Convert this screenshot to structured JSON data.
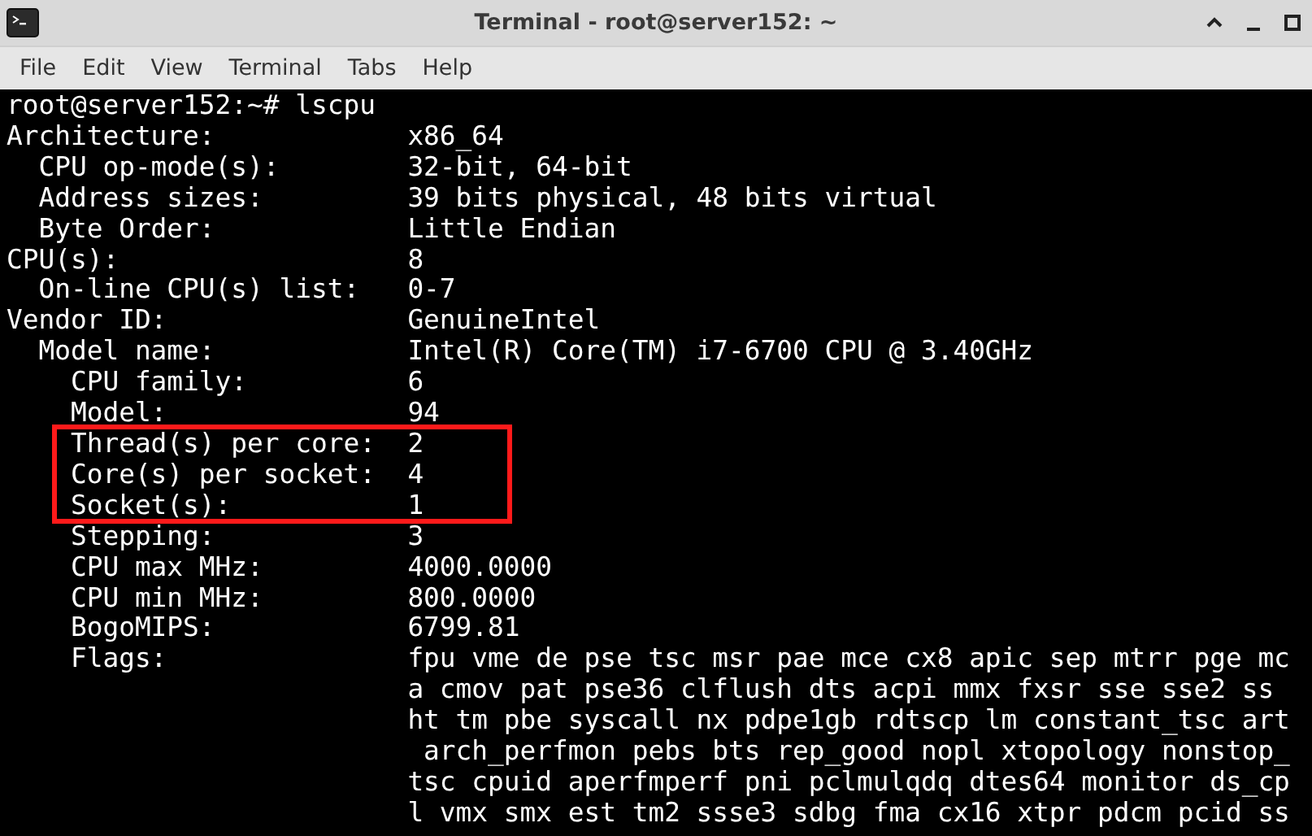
{
  "window": {
    "title": "Terminal - root@server152: ~"
  },
  "menu": [
    "File",
    "Edit",
    "View",
    "Terminal",
    "Tabs",
    "Help"
  ],
  "terminal": {
    "prompt": "root@server152:~# lscpu",
    "fields": [
      {
        "key": "Architecture:",
        "value": [
          "x86_64"
        ],
        "highlighted": false,
        "children": [
          {
            "key": "CPU op-mode(s):",
            "value": [
              "32-bit, 64-bit"
            ],
            "highlighted": false
          },
          {
            "key": "Address sizes:",
            "value": [
              "39 bits physical, 48 bits virtual"
            ],
            "highlighted": false
          },
          {
            "key": "Byte Order:",
            "value": [
              "Little Endian"
            ],
            "highlighted": false
          }
        ]
      },
      {
        "key": "CPU(s):",
        "value": [
          "8"
        ],
        "highlighted": false,
        "children": [
          {
            "key": "On-line CPU(s) list:",
            "value": [
              "0-7"
            ],
            "highlighted": false
          }
        ]
      },
      {
        "key": "Vendor ID:",
        "value": [
          "GenuineIntel"
        ],
        "highlighted": false,
        "children": [
          {
            "key": "Model name:",
            "value": [
              "Intel(R) Core(TM) i7-6700 CPU @ 3.40GHz"
            ],
            "highlighted": false,
            "children": [
              {
                "key": "CPU family:",
                "value": [
                  "6"
                ],
                "highlighted": false
              },
              {
                "key": "Model:",
                "value": [
                  "94"
                ],
                "highlighted": false
              },
              {
                "key": "Thread(s) per core:",
                "value": [
                  "2"
                ],
                "highlighted": true
              },
              {
                "key": "Core(s) per socket:",
                "value": [
                  "4"
                ],
                "highlighted": true
              },
              {
                "key": "Socket(s):",
                "value": [
                  "1"
                ],
                "highlighted": true
              },
              {
                "key": "Stepping:",
                "value": [
                  "3"
                ],
                "highlighted": false
              },
              {
                "key": "CPU max MHz:",
                "value": [
                  "4000.0000"
                ],
                "highlighted": false
              },
              {
                "key": "CPU min MHz:",
                "value": [
                  "800.0000"
                ],
                "highlighted": false
              },
              {
                "key": "BogoMIPS:",
                "value": [
                  "6799.81"
                ],
                "highlighted": false
              },
              {
                "key": "Flags:",
                "value": [
                  "fpu vme de pse tsc msr pae mce cx8 apic sep mtrr pge mc",
                  "a cmov pat pse36 clflush dts acpi mmx fxsr sse sse2 ss",
                  "ht tm pbe syscall nx pdpe1gb rdtscp lm constant_tsc art",
                  " arch_perfmon pebs bts rep_good nopl xtopology nonstop_",
                  "tsc cpuid aperfmperf pni pclmulqdq dtes64 monitor ds_cp",
                  "l vmx smx est tm2 ssse3 sdbg fma cx16 xtpr pdcm pcid ss"
                ],
                "highlighted": false
              }
            ]
          }
        ]
      }
    ]
  }
}
